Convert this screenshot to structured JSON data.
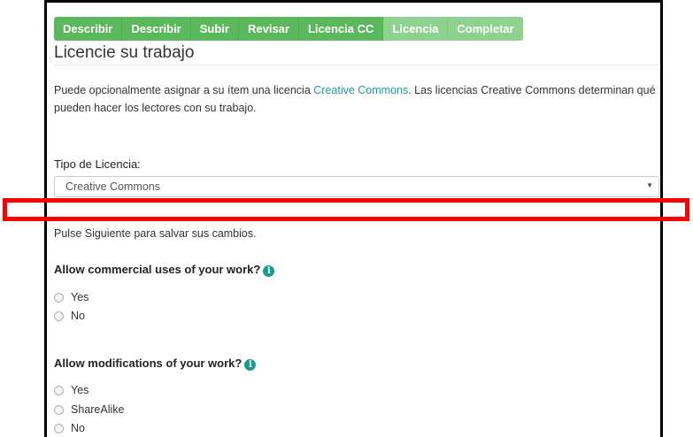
{
  "progress": {
    "steps": [
      {
        "label": "Describir",
        "state": "done"
      },
      {
        "label": "Describir",
        "state": "done"
      },
      {
        "label": "Subir",
        "state": "done"
      },
      {
        "label": "Revisar",
        "state": "done"
      },
      {
        "label": "Licencia CC",
        "state": "done"
      },
      {
        "label": "Licencia",
        "state": "pending"
      },
      {
        "label": "Completar",
        "state": "pending"
      }
    ],
    "colors": {
      "done": "#5cb85c",
      "pending": "#8fd18f"
    }
  },
  "page": {
    "title": "Licencie su trabajo",
    "intro_before": "Puede opcionalmente asignar a su ítem una licencia ",
    "intro_link": "Creative Commons",
    "intro_after": ". Las licencias Creative Commons determinan qué pueden hacer los lectores con su trabajo."
  },
  "license_select": {
    "label": "Tipo de Licencia:",
    "value": "Creative Commons"
  },
  "help_text": "Pulse Siguiente para salvar sus cambios.",
  "commercial": {
    "question": "Allow commercial uses of your work?",
    "options": [
      "Yes",
      "No"
    ]
  },
  "modifications": {
    "question": "Allow modifications of your work?",
    "options": [
      "Yes",
      "ShareAlike",
      "No"
    ]
  },
  "icons": {
    "info": "info-circle-icon",
    "select_arrow": "caret-down-icon"
  },
  "accent_color": "#1a9d8f",
  "highlight_color": "#ff0000"
}
